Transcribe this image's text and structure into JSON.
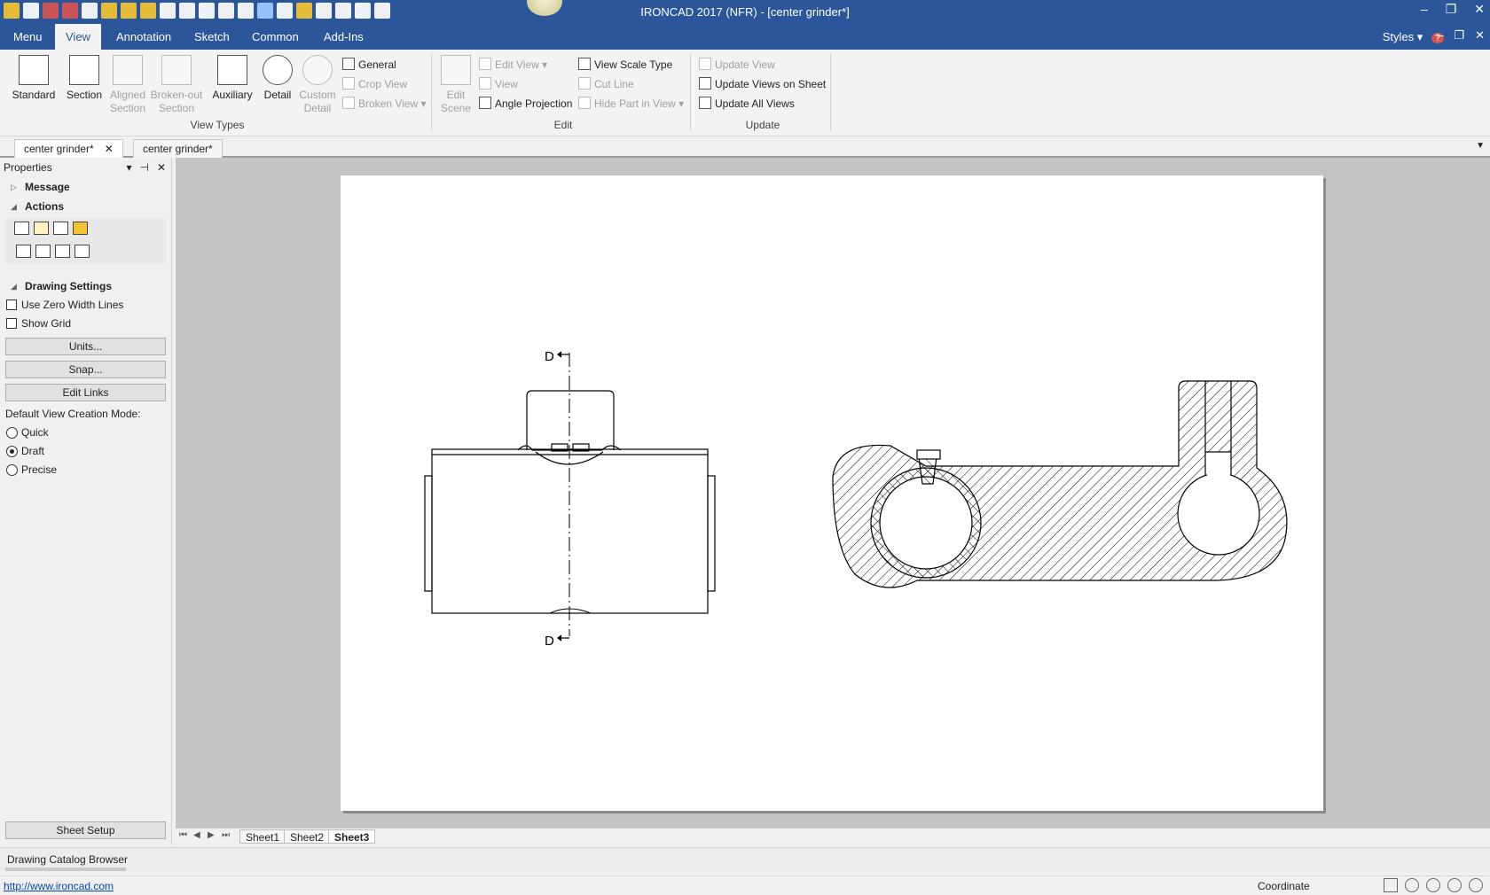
{
  "app": {
    "title": "IRONCAD 2017 (NFR) - [center grinder*]",
    "window_controls": [
      "–",
      "❐",
      "✕"
    ]
  },
  "ribbon_tabs": {
    "menu": "Menu",
    "view": "View",
    "annotation": "Annotation",
    "sketch": "Sketch",
    "common": "Common",
    "addins": "Add-Ins",
    "styles": "Styles",
    "styles_arrow": "▾",
    "help": "?",
    "doc_controls": [
      "–",
      "❐",
      "✕"
    ]
  },
  "ribbon": {
    "view_types": {
      "standard": "Standard",
      "section": "Section",
      "aligned_section": [
        "Aligned",
        "Section"
      ],
      "broken_out_section": [
        "Broken-out",
        "Section"
      ],
      "auxiliary": "Auxiliary",
      "detail": "Detail",
      "custom_detail": [
        "Custom",
        "Detail"
      ],
      "general": "General",
      "crop_view": "Crop View",
      "broken_view": "Broken View",
      "label": "View Types"
    },
    "edit": {
      "edit_scene": [
        "Edit",
        "Scene"
      ],
      "edit_view": "Edit View",
      "view": "View",
      "angle_projection": "Angle Projection",
      "view_scale_type": "View Scale Type",
      "cut_line": "Cut Line",
      "hide_part_in_view": "Hide Part in View",
      "label": "Edit"
    },
    "update": {
      "update_view": "Update View",
      "update_views_on_sheet": "Update Views on Sheet",
      "update_all_views": "Update All Views",
      "label": "Update"
    }
  },
  "doc_tabs": [
    {
      "label": "center grinder*",
      "close": "✕"
    },
    {
      "label": "center grinder*"
    }
  ],
  "properties": {
    "title": "Properties",
    "controls": [
      "▾",
      "⊣",
      "✕"
    ],
    "message": "Message",
    "actions": "Actions",
    "drawing_settings": "Drawing Settings",
    "use_zero_width_lines": "Use Zero Width Lines",
    "show_grid": "Show Grid",
    "units_button": "Units...",
    "snap_button": "Snap...",
    "edit_links_button": "Edit Links",
    "default_view_creation_mode": "Default View Creation Mode:",
    "modes": [
      "Quick",
      "Draft",
      "Precise"
    ],
    "selected_mode": "Draft",
    "sheet_setup_button": "Sheet Setup"
  },
  "drawing": {
    "section_label_top": "D",
    "section_label_bottom": "D"
  },
  "sheets": {
    "nav": [
      "⏮",
      "◀",
      "▶",
      "⏭"
    ],
    "tabs": [
      "Sheet1",
      "Sheet2",
      "Sheet3"
    ],
    "active": "Sheet3"
  },
  "catalog": {
    "label": "Drawing Catalog Browser"
  },
  "status": {
    "link": "http://www.ironcad.com",
    "coordinate": "Coordinate"
  },
  "colors": {
    "titlebar": "#2b579a",
    "ribbon": "#f3f3f3",
    "canvas": "#c4c4c4",
    "paper": "#ffffff"
  }
}
